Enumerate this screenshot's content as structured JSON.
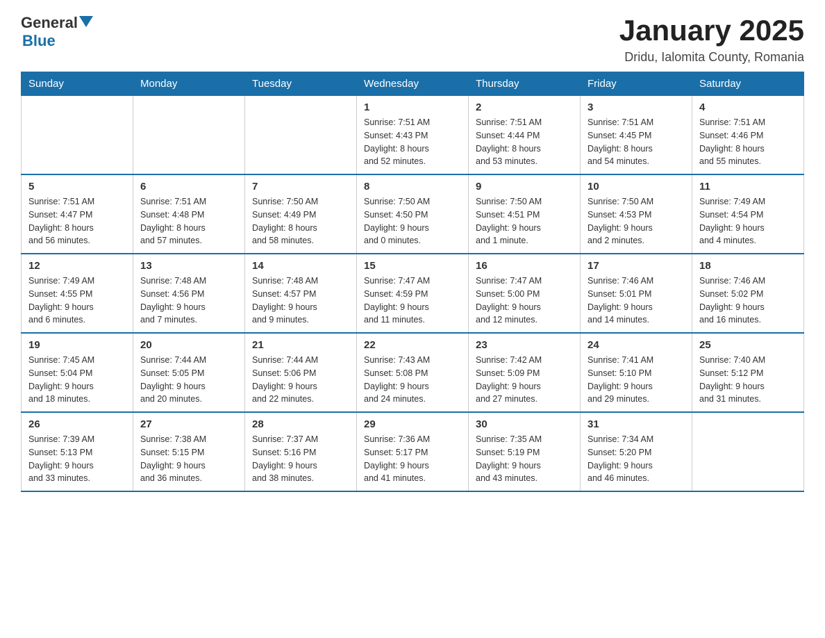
{
  "header": {
    "logo": {
      "general": "General",
      "blue": "Blue",
      "tagline": ""
    },
    "title": "January 2025",
    "subtitle": "Dridu, Ialomita County, Romania"
  },
  "days_of_week": [
    "Sunday",
    "Monday",
    "Tuesday",
    "Wednesday",
    "Thursday",
    "Friday",
    "Saturday"
  ],
  "weeks": [
    {
      "days": [
        {
          "number": "",
          "info": ""
        },
        {
          "number": "",
          "info": ""
        },
        {
          "number": "",
          "info": ""
        },
        {
          "number": "1",
          "info": "Sunrise: 7:51 AM\nSunset: 4:43 PM\nDaylight: 8 hours\nand 52 minutes."
        },
        {
          "number": "2",
          "info": "Sunrise: 7:51 AM\nSunset: 4:44 PM\nDaylight: 8 hours\nand 53 minutes."
        },
        {
          "number": "3",
          "info": "Sunrise: 7:51 AM\nSunset: 4:45 PM\nDaylight: 8 hours\nand 54 minutes."
        },
        {
          "number": "4",
          "info": "Sunrise: 7:51 AM\nSunset: 4:46 PM\nDaylight: 8 hours\nand 55 minutes."
        }
      ]
    },
    {
      "days": [
        {
          "number": "5",
          "info": "Sunrise: 7:51 AM\nSunset: 4:47 PM\nDaylight: 8 hours\nand 56 minutes."
        },
        {
          "number": "6",
          "info": "Sunrise: 7:51 AM\nSunset: 4:48 PM\nDaylight: 8 hours\nand 57 minutes."
        },
        {
          "number": "7",
          "info": "Sunrise: 7:50 AM\nSunset: 4:49 PM\nDaylight: 8 hours\nand 58 minutes."
        },
        {
          "number": "8",
          "info": "Sunrise: 7:50 AM\nSunset: 4:50 PM\nDaylight: 9 hours\nand 0 minutes."
        },
        {
          "number": "9",
          "info": "Sunrise: 7:50 AM\nSunset: 4:51 PM\nDaylight: 9 hours\nand 1 minute."
        },
        {
          "number": "10",
          "info": "Sunrise: 7:50 AM\nSunset: 4:53 PM\nDaylight: 9 hours\nand 2 minutes."
        },
        {
          "number": "11",
          "info": "Sunrise: 7:49 AM\nSunset: 4:54 PM\nDaylight: 9 hours\nand 4 minutes."
        }
      ]
    },
    {
      "days": [
        {
          "number": "12",
          "info": "Sunrise: 7:49 AM\nSunset: 4:55 PM\nDaylight: 9 hours\nand 6 minutes."
        },
        {
          "number": "13",
          "info": "Sunrise: 7:48 AM\nSunset: 4:56 PM\nDaylight: 9 hours\nand 7 minutes."
        },
        {
          "number": "14",
          "info": "Sunrise: 7:48 AM\nSunset: 4:57 PM\nDaylight: 9 hours\nand 9 minutes."
        },
        {
          "number": "15",
          "info": "Sunrise: 7:47 AM\nSunset: 4:59 PM\nDaylight: 9 hours\nand 11 minutes."
        },
        {
          "number": "16",
          "info": "Sunrise: 7:47 AM\nSunset: 5:00 PM\nDaylight: 9 hours\nand 12 minutes."
        },
        {
          "number": "17",
          "info": "Sunrise: 7:46 AM\nSunset: 5:01 PM\nDaylight: 9 hours\nand 14 minutes."
        },
        {
          "number": "18",
          "info": "Sunrise: 7:46 AM\nSunset: 5:02 PM\nDaylight: 9 hours\nand 16 minutes."
        }
      ]
    },
    {
      "days": [
        {
          "number": "19",
          "info": "Sunrise: 7:45 AM\nSunset: 5:04 PM\nDaylight: 9 hours\nand 18 minutes."
        },
        {
          "number": "20",
          "info": "Sunrise: 7:44 AM\nSunset: 5:05 PM\nDaylight: 9 hours\nand 20 minutes."
        },
        {
          "number": "21",
          "info": "Sunrise: 7:44 AM\nSunset: 5:06 PM\nDaylight: 9 hours\nand 22 minutes."
        },
        {
          "number": "22",
          "info": "Sunrise: 7:43 AM\nSunset: 5:08 PM\nDaylight: 9 hours\nand 24 minutes."
        },
        {
          "number": "23",
          "info": "Sunrise: 7:42 AM\nSunset: 5:09 PM\nDaylight: 9 hours\nand 27 minutes."
        },
        {
          "number": "24",
          "info": "Sunrise: 7:41 AM\nSunset: 5:10 PM\nDaylight: 9 hours\nand 29 minutes."
        },
        {
          "number": "25",
          "info": "Sunrise: 7:40 AM\nSunset: 5:12 PM\nDaylight: 9 hours\nand 31 minutes."
        }
      ]
    },
    {
      "days": [
        {
          "number": "26",
          "info": "Sunrise: 7:39 AM\nSunset: 5:13 PM\nDaylight: 9 hours\nand 33 minutes."
        },
        {
          "number": "27",
          "info": "Sunrise: 7:38 AM\nSunset: 5:15 PM\nDaylight: 9 hours\nand 36 minutes."
        },
        {
          "number": "28",
          "info": "Sunrise: 7:37 AM\nSunset: 5:16 PM\nDaylight: 9 hours\nand 38 minutes."
        },
        {
          "number": "29",
          "info": "Sunrise: 7:36 AM\nSunset: 5:17 PM\nDaylight: 9 hours\nand 41 minutes."
        },
        {
          "number": "30",
          "info": "Sunrise: 7:35 AM\nSunset: 5:19 PM\nDaylight: 9 hours\nand 43 minutes."
        },
        {
          "number": "31",
          "info": "Sunrise: 7:34 AM\nSunset: 5:20 PM\nDaylight: 9 hours\nand 46 minutes."
        },
        {
          "number": "",
          "info": ""
        }
      ]
    }
  ]
}
